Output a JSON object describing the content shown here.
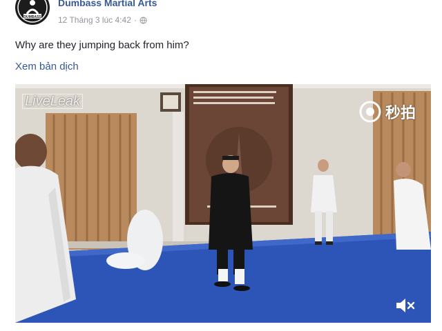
{
  "post": {
    "page_name": "Dumbass Martial Arts",
    "avatar_label": "DUMBASS",
    "timestamp": "12 Tháng 3 lúc 4:42",
    "text": "Why are they jumping back from him?",
    "see_translation": "Xem bản dịch"
  },
  "video": {
    "watermark_left": "LiveLeak",
    "watermark_right": "秒拍"
  },
  "icons": {
    "globe": "globe-icon",
    "play_eye": "miaopai-logo-icon",
    "volume": "volume-mute-icon"
  },
  "colors": {
    "link": "#365899",
    "text": "#1d2129",
    "meta": "#90949c",
    "floor": "#2d55b8"
  }
}
